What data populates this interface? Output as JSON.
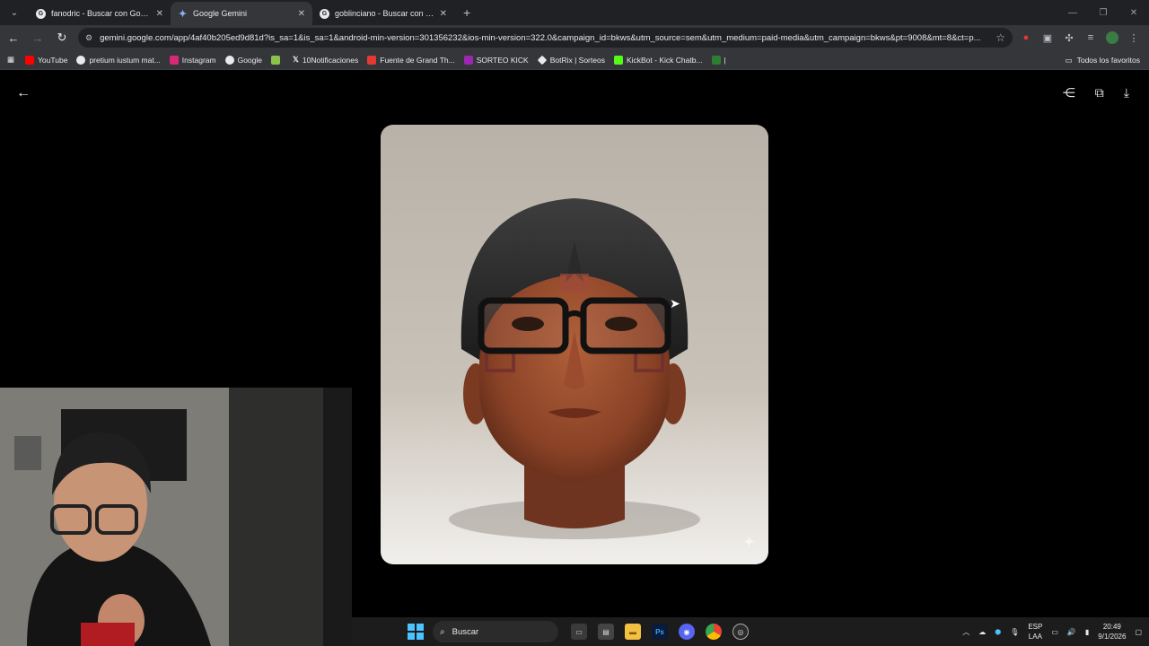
{
  "browser": {
    "tabs": [
      {
        "title": "fanodric - Buscar con Google",
        "active": false,
        "icon": "google-icon"
      },
      {
        "title": "Google Gemini",
        "active": true,
        "icon": "gemini-icon"
      },
      {
        "title": "goblinciano - Buscar con Google",
        "active": false,
        "icon": "google-icon"
      }
    ],
    "url": "gemini.google.com/app/4af40b205ed9d81d?is_sa=1&is_sa=1&android-min-version=301356232&ios-min-version=322.0&campaign_id=bkws&utm_source=sem&utm_medium=paid-media&utm_campaign=bkws&pt=9008&mt=8&ct=p...",
    "bookmarks": [
      {
        "label": "YouTube",
        "color": "#ff0000"
      },
      {
        "label": "pretium iustum mat...",
        "color": "#e8eaed"
      },
      {
        "label": "Instagram",
        "color": "#d62976"
      },
      {
        "label": "Google",
        "color": "#e8eaed"
      },
      {
        "label": "",
        "color": "#8bc34a"
      },
      {
        "label": "10Notificaciones",
        "color": "#000000"
      },
      {
        "label": "Fuente de Grand Th...",
        "color": "#e53935"
      },
      {
        "label": "SORTEO KICK",
        "color": "#9c27b0"
      },
      {
        "label": "BotRix | Sorteos",
        "color": "#e8eaed"
      },
      {
        "label": "KickBot - Kick Chatb...",
        "color": "#53fc18"
      },
      {
        "label": "|",
        "color": "#35363a"
      }
    ],
    "all_bookmarks_label": "Todos los favoritos"
  },
  "viewer": {
    "image_alt": "Sculpted head bust with black glasses and face paint",
    "tools": [
      "share-icon",
      "copy-icon",
      "download-icon"
    ]
  },
  "taskbar": {
    "search_label": "Buscar",
    "lang_top": "ESP",
    "lang_bottom": "LAA",
    "time": "20:49",
    "date": "9/1/2026"
  }
}
